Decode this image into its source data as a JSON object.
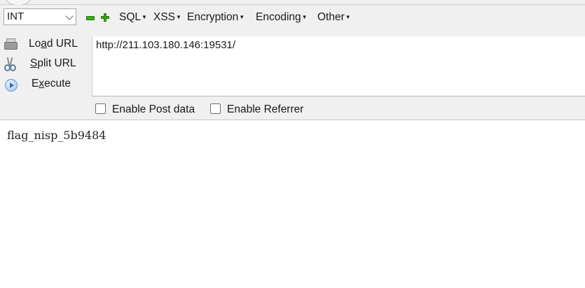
{
  "toolbar": {
    "select_value": "INT",
    "menus": [
      {
        "label": "SQL"
      },
      {
        "label": "XSS"
      },
      {
        "label": "Encryption"
      },
      {
        "label": "Encoding"
      },
      {
        "label": "Other"
      }
    ]
  },
  "actions": {
    "load_url": {
      "pre": "Lo",
      "key": "a",
      "post": "d URL"
    },
    "split_url": {
      "pre": "",
      "key": "S",
      "post": "plit URL"
    },
    "execute": {
      "pre": "E",
      "key": "x",
      "post": "ecute"
    }
  },
  "url_value": "http://211.103.180.146:19531/",
  "options": {
    "post_data_label": "Enable Post data",
    "referrer_label": "Enable Referrer"
  },
  "page_content": "flag_nisp_5b9484",
  "colors": {
    "accent_green": "#3ea815",
    "panel_bg": "#f0f0f0"
  }
}
